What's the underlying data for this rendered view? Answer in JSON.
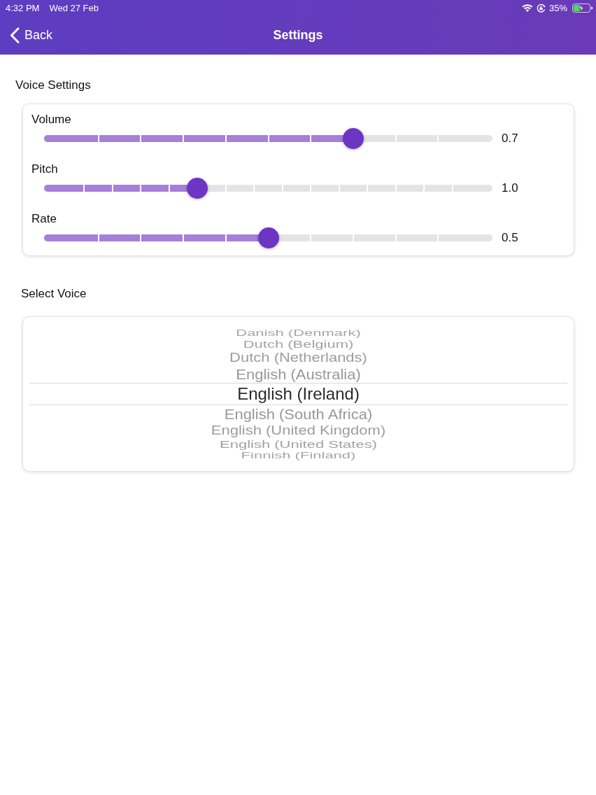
{
  "status_bar": {
    "time": "4:32 PM",
    "date": "Wed 27 Feb",
    "battery": "35%"
  },
  "nav_bar": {
    "back": "Back",
    "title": "Settings"
  },
  "voice_settings": {
    "heading": "Voice Settings",
    "sliders": [
      {
        "label": "Volume",
        "level": 0.7,
        "reading": "0.7"
      },
      {
        "label": "Pitch",
        "level": 0.333,
        "reading": "1.0"
      },
      {
        "label": "Rate",
        "level": 0.5,
        "reading": "0.5"
      }
    ]
  },
  "select_voice": {
    "heading": "Select Voice",
    "options": [
      {
        "label": "Danish (Denmark)",
        "selected": false
      },
      {
        "label": "Dutch (Belgium)",
        "selected": false
      },
      {
        "label": "Dutch (Netherlands)",
        "selected": false
      },
      {
        "label": "English (Australia)",
        "selected": false
      },
      {
        "label": "English (Ireland)",
        "selected": true
      },
      {
        "label": "English (South Africa)",
        "selected": false
      },
      {
        "label": "English (United Kingdom)",
        "selected": false
      },
      {
        "label": "English (United States)",
        "selected": false
      },
      {
        "label": "Finnish (Finland)",
        "selected": false
      }
    ]
  }
}
